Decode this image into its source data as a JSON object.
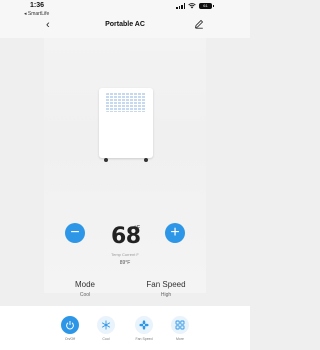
{
  "status_bar": {
    "time": "1:36",
    "back_app": "◂ SmartLife",
    "battery": "61"
  },
  "header": {
    "title": "Portable AC",
    "back_icon": "chevron-left-icon",
    "edit_icon": "pencil-icon"
  },
  "temperature": {
    "set_value": "68",
    "unit": "°F",
    "current_label": "Temp Current F",
    "current_value": "89°F",
    "minus_label": "−",
    "plus_label": "+"
  },
  "settings": {
    "mode_label": "Mode",
    "mode_value": "Cool",
    "fan_label": "Fan Speed",
    "fan_value": "High"
  },
  "tabs": [
    {
      "label": "On/Off",
      "icon": "power-icon",
      "active": true
    },
    {
      "label": "Cool",
      "icon": "snowflake-icon",
      "active": false
    },
    {
      "label": "Fan Speed",
      "icon": "fan-icon",
      "active": false
    },
    {
      "label": "More",
      "icon": "grid-icon",
      "active": false
    }
  ],
  "colors": {
    "accent": "#2e96e6",
    "accent_light": "#e9f3fc",
    "background": "#efefef"
  }
}
